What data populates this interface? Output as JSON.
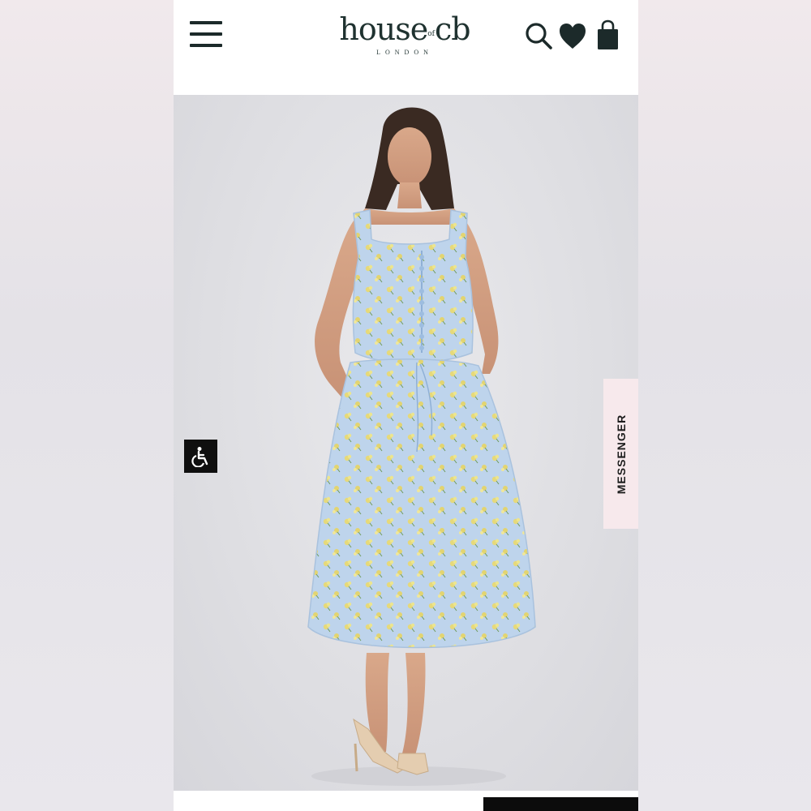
{
  "header": {
    "logo_main": "house",
    "logo_of": "of",
    "logo_cb": "cb",
    "logo_sub": "LONDON"
  },
  "icons": {
    "menu": "hamburger-menu-icon",
    "search": "search-icon",
    "wishlist": "heart-icon",
    "bag": "shopping-bag-icon",
    "accessibility": "wheelchair-accessibility-icon"
  },
  "colors": {
    "brand": "#1f3230",
    "dress_blue": "#bcd3ec",
    "flower_yellow": "#e4d67a",
    "messenger_bg": "#f7e9ec"
  },
  "messenger": {
    "label": "MESSENGER"
  }
}
